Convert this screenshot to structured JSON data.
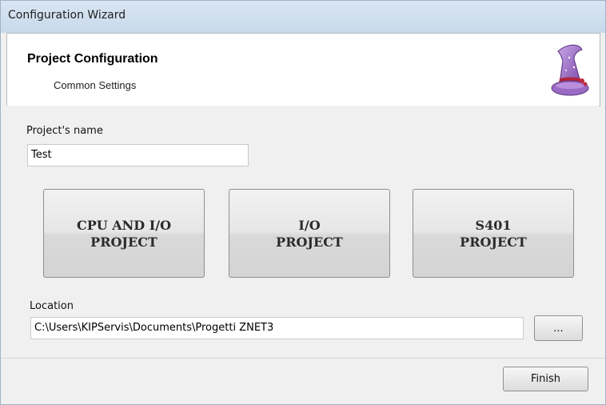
{
  "window": {
    "title": "Configuration Wizard"
  },
  "header": {
    "title": "Project Configuration",
    "subtitle": "Common Settings",
    "icon": "wizard-hat-icon"
  },
  "project_name": {
    "label": "Project's name",
    "value": "Test"
  },
  "project_buttons": [
    {
      "label": "CPU AND I/O\nPROJECT"
    },
    {
      "label": "I/O\nPROJECT"
    },
    {
      "label": "S401\nPROJECT"
    }
  ],
  "location": {
    "label": "Location",
    "value": "C:\\Users\\KIPServis\\Documents\\Progetti ZNET3",
    "browse_label": "..."
  },
  "footer": {
    "finish_label": "Finish"
  }
}
